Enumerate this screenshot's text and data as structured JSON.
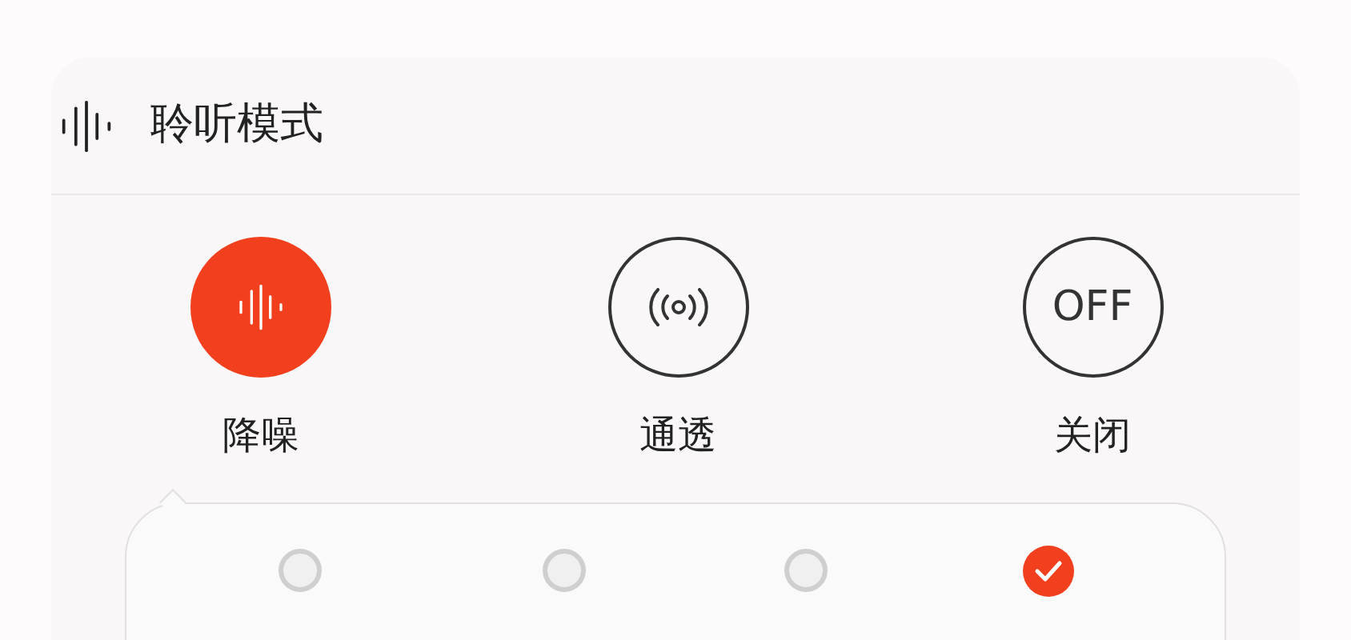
{
  "header": {
    "title": "聆听模式"
  },
  "modes": [
    {
      "kind": "wave",
      "label": "降噪",
      "selected": true
    },
    {
      "kind": "radio",
      "label": "通透",
      "selected": false
    },
    {
      "kind": "text",
      "icon_text": "OFF",
      "label": "关闭",
      "selected": false
    }
  ],
  "options": [
    {
      "selected": false
    },
    {
      "selected": false
    },
    {
      "selected": false
    },
    {
      "selected": true
    }
  ]
}
